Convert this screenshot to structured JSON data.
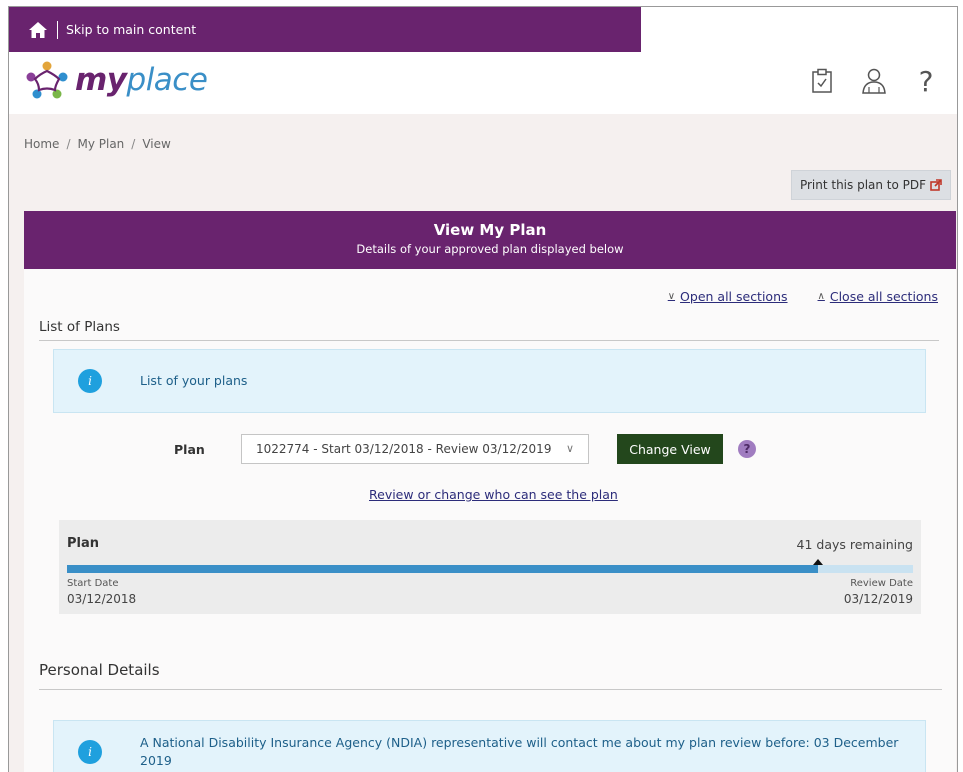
{
  "skip_bar": {
    "link_label": "Skip to main content"
  },
  "header": {
    "logo": {
      "bold": "my",
      "light": "place"
    },
    "icons": [
      "clipboard-check-icon",
      "user-icon",
      "help-icon"
    ],
    "help_glyph": "?"
  },
  "breadcrumb": {
    "items": [
      "Home",
      "My Plan",
      "View"
    ],
    "separator": "/"
  },
  "print_button": {
    "label": "Print this plan to PDF"
  },
  "panel": {
    "title": "View My Plan",
    "subtitle": "Details of your approved plan displayed below"
  },
  "toggles": {
    "open_all": "Open all sections",
    "close_all": "Close all sections"
  },
  "list_of_plans": {
    "title": "List of Plans",
    "info_text": "List of your plans",
    "plan_label": "Plan",
    "plan_selected": "1022774 - Start 03/12/2018 - Review 03/12/2019",
    "change_view_label": "Change View",
    "help_glyph": "?",
    "review_link": "Review or change who can see the plan"
  },
  "plan_progress": {
    "title": "Plan",
    "days_remaining": "41 days remaining",
    "progress_fraction": 0.888,
    "start_label": "Start Date",
    "start_value": "03/12/2018",
    "review_label": "Review Date",
    "review_value": "03/12/2019"
  },
  "personal_details": {
    "title": "Personal Details",
    "info_text": "A National Disability Insurance Agency (NDIA) representative will contact me about my plan review before: 03 December 2019"
  },
  "colors": {
    "brand_purple": "#69236e",
    "info_blue": "#1fa0de",
    "progress_blue": "#3a8fc7",
    "button_green": "#23471c"
  }
}
